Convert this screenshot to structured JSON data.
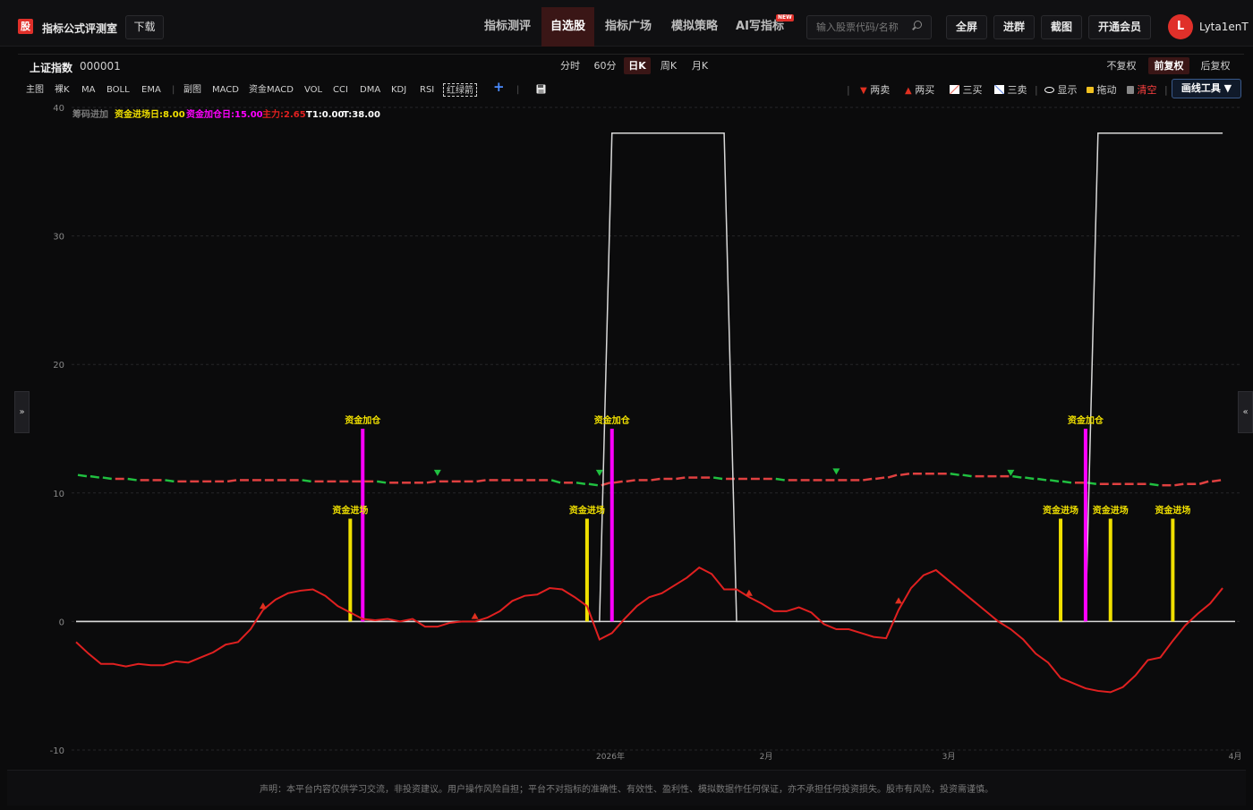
{
  "header": {
    "logo_char": "股",
    "app_title": "指标公式评测室",
    "download": "下载",
    "nav": [
      {
        "label": "指标测评",
        "active": false
      },
      {
        "label": "自选股",
        "active": true
      },
      {
        "label": "指标广场",
        "active": false
      },
      {
        "label": "模拟策略",
        "active": false
      },
      {
        "label": "AI写指标",
        "active": false
      }
    ],
    "new_badge": "NEW",
    "search_placeholder": "输入股票代码/名称",
    "buttons": [
      "全屏",
      "进群",
      "截图",
      "开通会员"
    ],
    "avatar_letter": "L",
    "username": "Lyta1enT"
  },
  "symbol": {
    "name": "上证指数",
    "code": "000001"
  },
  "periods": [
    {
      "label": "分时",
      "active": false
    },
    {
      "label": "60分",
      "active": false
    },
    {
      "label": "日K",
      "active": true
    },
    {
      "label": "周K",
      "active": false
    },
    {
      "label": "月K",
      "active": false
    }
  ],
  "adjust": [
    {
      "label": "不复权",
      "active": false
    },
    {
      "label": "前复权",
      "active": true
    },
    {
      "label": "后复权",
      "active": false
    }
  ],
  "toolbar": {
    "main": [
      "主图",
      "裸K",
      "MA",
      "BOLL",
      "EMA"
    ],
    "sub": [
      "副图",
      "MACD",
      "资金MACD",
      "VOL",
      "CCI",
      "DMA",
      "KDJ",
      "RSI"
    ],
    "active_indicator": "红绿箭",
    "plus": "+",
    "right": [
      "两卖",
      "两买",
      "三买",
      "三卖",
      "显示",
      "拖动",
      "清空"
    ],
    "draw_tools": "画线工具 ▼"
  },
  "side": {
    "left": "»",
    "right": "«"
  },
  "legend": [
    {
      "text": "筹码进加",
      "color": "#7a7a7a"
    },
    {
      "text": "资金进场日:8.00",
      "color": "#f0e000"
    },
    {
      "text": "资金加仓日:15.00",
      "color": "#ff00ff"
    },
    {
      "text": "主力:2.65",
      "color": "#e02020"
    },
    {
      "text": "T1:0.00",
      "color": "#ffffff"
    },
    {
      "text": "T:38.00",
      "color": "#ffffff"
    }
  ],
  "chart_data": {
    "type": "line",
    "ylim": [
      -10,
      40
    ],
    "yticks": [
      40,
      30,
      20,
      10,
      0,
      -10
    ],
    "xticks": [
      "2026年",
      "2月",
      "3月",
      "4月"
    ],
    "n": 94,
    "series": [
      {
        "name": "主力",
        "color": "#e02020",
        "values": [
          -1.6,
          -2.5,
          -3.3,
          -3.3,
          -3.5,
          -3.3,
          -3.4,
          -3.4,
          -3.1,
          -3.2,
          -2.8,
          -2.4,
          -1.8,
          -1.6,
          -0.6,
          0.9,
          1.7,
          2.2,
          2.4,
          2.5,
          2.0,
          1.2,
          0.7,
          0.2,
          0.1,
          0.2,
          0.0,
          0.2,
          -0.4,
          -0.4,
          -0.1,
          0.0,
          0.0,
          0.3,
          0.8,
          1.6,
          2.0,
          2.1,
          2.6,
          2.5,
          1.9,
          1.2,
          -1.4,
          -0.9,
          0.2,
          1.2,
          1.9,
          2.2,
          2.8,
          3.4,
          4.2,
          3.7,
          2.5,
          2.5,
          1.9,
          1.4,
          0.8,
          0.8,
          1.1,
          0.7,
          -0.2,
          -0.6,
          -0.6,
          -0.9,
          -1.2,
          -1.3,
          0.9,
          2.6,
          3.6,
          4.0,
          3.2,
          2.4,
          1.6,
          0.8,
          0.0,
          -0.6,
          -1.4,
          -2.5,
          -3.2,
          -4.4,
          -4.8,
          -5.2,
          -5.4,
          -5.5,
          -5.1,
          -4.2,
          -3.0,
          -2.8,
          -1.5,
          -0.3,
          0.6,
          1.4,
          2.6
        ]
      },
      {
        "name": "T",
        "color": "#d8d8d8",
        "values": [
          0,
          0,
          0,
          0,
          0,
          0,
          0,
          0,
          0,
          0,
          0,
          0,
          0,
          0,
          0,
          0,
          0,
          0,
          0,
          0,
          0,
          0,
          0,
          0,
          0,
          0,
          0,
          0,
          0,
          0,
          0,
          0,
          0,
          0,
          0,
          0,
          0,
          0,
          0,
          0,
          0,
          0,
          0,
          38,
          38,
          38,
          38,
          38,
          38,
          38,
          38,
          38,
          38,
          0,
          0,
          0,
          0,
          0,
          0,
          0,
          0,
          0,
          0,
          0,
          0,
          0,
          0,
          0,
          0,
          0,
          0,
          0,
          0,
          0,
          0,
          0,
          0,
          0,
          0,
          0,
          0,
          0,
          38,
          38,
          38,
          38,
          38,
          38,
          38,
          38,
          38,
          38,
          38
        ]
      },
      {
        "name": "K",
        "color": "#20c040",
        "values": [
          11.4,
          11.3,
          11.2,
          11.1,
          11.1,
          11.0,
          11.0,
          11.0,
          10.9,
          10.9,
          10.9,
          10.9,
          10.9,
          11.0,
          11.0,
          11.0,
          11.0,
          11.0,
          11.0,
          10.9,
          10.9,
          10.9,
          10.9,
          10.9,
          10.9,
          10.8,
          10.8,
          10.8,
          10.8,
          10.9,
          10.9,
          10.9,
          10.9,
          11.0,
          11.0,
          11.0,
          11.0,
          11.0,
          11.0,
          10.8,
          10.8,
          10.7,
          10.6,
          10.8,
          10.9,
          11.0,
          11.0,
          11.1,
          11.1,
          11.2,
          11.2,
          11.2,
          11.1,
          11.1,
          11.1,
          11.1,
          11.1,
          11.0,
          11.0,
          11.0,
          11.0,
          11.0,
          11.0,
          11.0,
          11.1,
          11.2,
          11.4,
          11.5,
          11.5,
          11.5,
          11.5,
          11.4,
          11.3,
          11.3,
          11.3,
          11.3,
          11.2,
          11.1,
          11.0,
          10.9,
          10.8,
          10.8,
          10.7,
          10.7,
          10.7,
          10.7,
          10.7,
          10.6,
          10.6,
          10.7,
          10.7,
          10.9,
          11.0
        ]
      },
      {
        "name": "资金进场",
        "color": "#f0e000",
        "bars": [
          [
            22,
            8
          ],
          [
            41,
            8
          ],
          [
            79,
            8
          ],
          [
            83,
            8
          ],
          [
            88,
            8
          ]
        ]
      },
      {
        "name": "资金加仓",
        "color": "#ff00ff",
        "bars": [
          [
            23,
            15
          ],
          [
            43,
            15
          ],
          [
            81,
            15
          ]
        ]
      }
    ],
    "annotations": [
      {
        "x": 22,
        "y": 8,
        "text": "资金进场",
        "color": "#f0e000"
      },
      {
        "x": 23,
        "y": 15,
        "text": "资金加仓",
        "color": "#f0e000"
      },
      {
        "x": 41,
        "y": 8,
        "text": "资金进场",
        "color": "#f0e000"
      },
      {
        "x": 43,
        "y": 15,
        "text": "资金加仓",
        "color": "#f0e000"
      },
      {
        "x": 79,
        "y": 8,
        "text": "资金进场",
        "color": "#f0e000"
      },
      {
        "x": 81,
        "y": 15,
        "text": "资金加仓",
        "color": "#f0e000"
      },
      {
        "x": 83,
        "y": 8,
        "text": "资金进场",
        "color": "#f0e000"
      },
      {
        "x": 88,
        "y": 8,
        "text": "资金进场",
        "color": "#f0e000"
      }
    ],
    "up_arrows": [
      {
        "x": 15,
        "y": 1.2
      },
      {
        "x": 32,
        "y": 0.4
      },
      {
        "x": 54,
        "y": 2.2
      },
      {
        "x": 66,
        "y": 1.6
      }
    ],
    "down_arrows": [
      {
        "x": 29,
        "y": 11.6
      },
      {
        "x": 42,
        "y": 11.6
      },
      {
        "x": 61,
        "y": 11.7
      },
      {
        "x": 75,
        "y": 11.6
      }
    ]
  },
  "footer": "声明：本平台内容仅供学习交流，非投资建议。用户操作风险自担；平台不对指标的准确性、有效性、盈利性、模拟数据作任何保证，亦不承担任何投资损失。股市有风险，投资需谨慎。"
}
